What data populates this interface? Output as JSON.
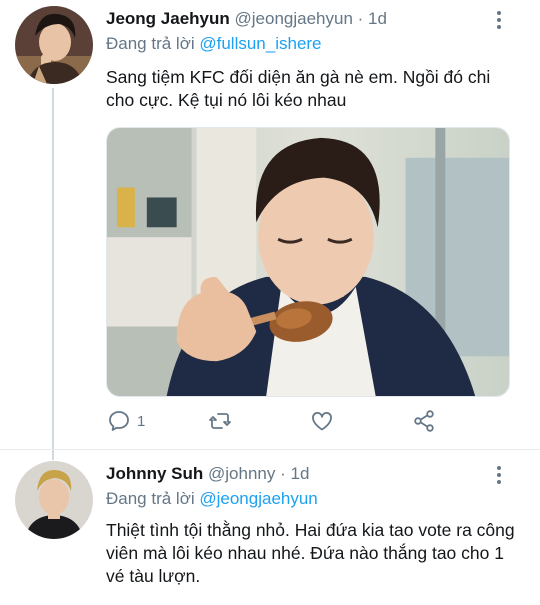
{
  "tweets": [
    {
      "name": "Jeong Jaehyun",
      "handle": "@jeongjaehyun",
      "sep": "·",
      "time": "1d",
      "reply_prefix": "Đang trả lời ",
      "reply_to": "@fullsun_ishere",
      "text": "Sang tiệm KFC đối diện ăn gà nè em. Ngồi đó chi cho cực. Kệ tụi nó lôi kéo nhau",
      "media": "photo-man-eating-fried-chicken",
      "actions": {
        "reply_count": "1",
        "retweet_count": "",
        "like_count": ""
      }
    },
    {
      "name": "Johnny Suh",
      "handle": "@johnny",
      "sep": "·",
      "time": "1d",
      "reply_prefix": "Đang trả lời ",
      "reply_to": "@jeongjaehyun",
      "text": "Thiệt tình tội thằng nhỏ. Hai đứa  kia tao vote ra công viên mà lôi kéo nhau nhé. Đứa nào thắng tao cho 1 vé tàu lượn."
    }
  ],
  "icons": {
    "reply": "reply-icon",
    "retweet": "retweet-icon",
    "like": "heart-icon",
    "share": "share-icon",
    "more": "more-vertical-icon"
  },
  "colors": {
    "link": "#1da1f2",
    "muted": "#657786",
    "text": "#14171a",
    "thread_line": "#cfd9de"
  }
}
